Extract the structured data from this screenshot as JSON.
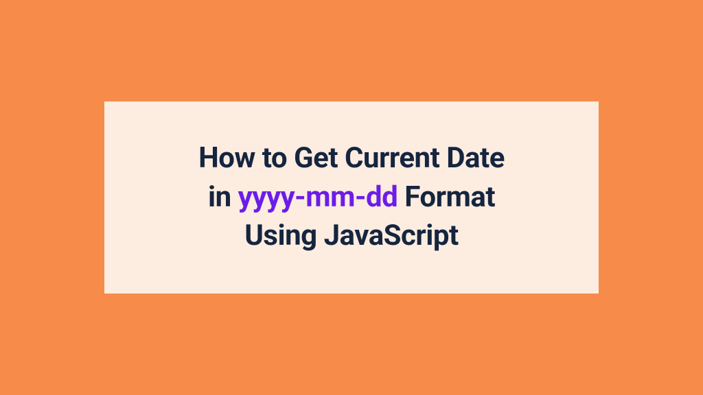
{
  "card": {
    "line1_prefix": "How to Get Current Date",
    "line2_prefix": "in ",
    "line2_highlight": "yyyy-mm-dd",
    "line2_suffix": " Format",
    "line3": "Using JavaScript"
  },
  "colors": {
    "background": "#f78c4a",
    "card": "#fdece0",
    "text": "#15253f",
    "highlight": "#6b1de8"
  }
}
